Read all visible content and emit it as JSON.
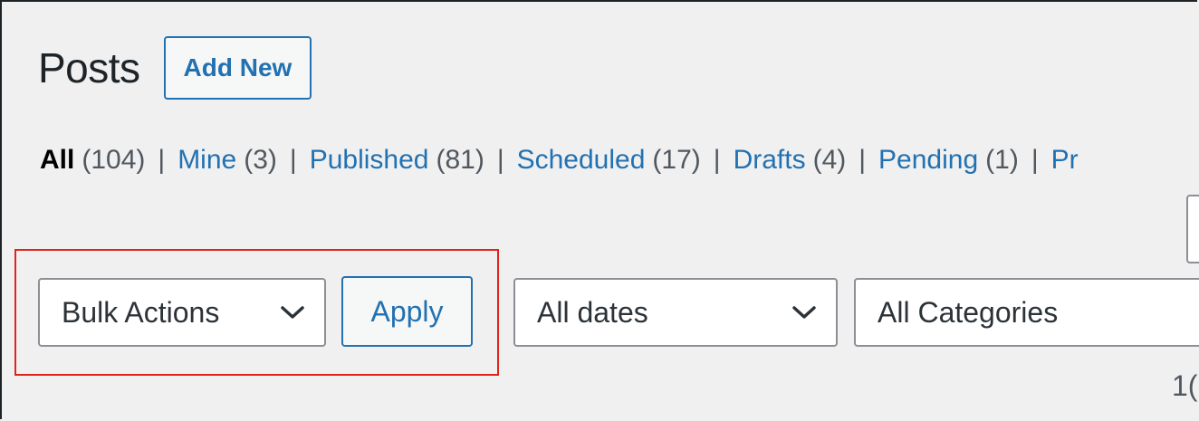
{
  "header": {
    "title": "Posts",
    "add_new_label": "Add New"
  },
  "status_filters": [
    {
      "label": "All",
      "count": "(104)",
      "current": true
    },
    {
      "label": "Mine",
      "count": "(3)",
      "current": false
    },
    {
      "label": "Published",
      "count": "(81)",
      "current": false
    },
    {
      "label": "Scheduled",
      "count": "(17)",
      "current": false
    },
    {
      "label": "Drafts",
      "count": "(4)",
      "current": false
    },
    {
      "label": "Pending",
      "count": "(1)",
      "current": false
    },
    {
      "label": "Pr",
      "count": "",
      "current": false
    }
  ],
  "separator": "|",
  "tablenav": {
    "bulk_actions_value": "Bulk Actions",
    "apply_label": "Apply",
    "dates_value": "All dates",
    "categories_value": "All Categories",
    "items_count_partial": "1("
  },
  "colors": {
    "link": "#2271b1",
    "highlight": "#e2231a",
    "background": "#f0f0f1"
  },
  "icons": {
    "dropdown": "chevron-down-icon"
  }
}
